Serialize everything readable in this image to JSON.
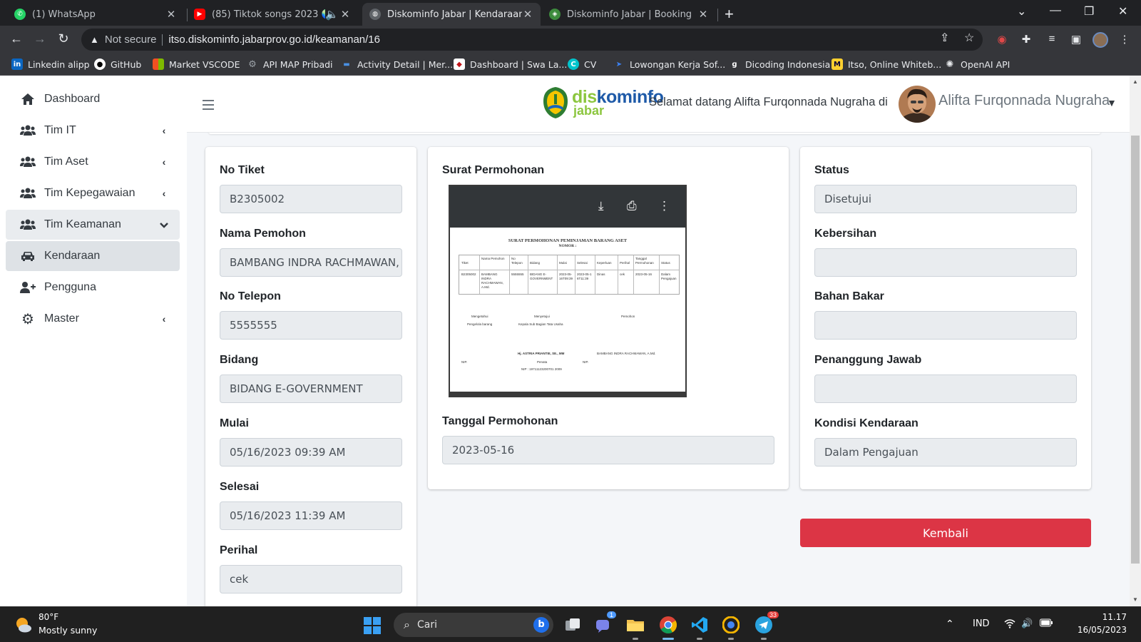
{
  "browser": {
    "tabs": [
      {
        "title": "(1) WhatsApp",
        "icon": "whatsapp-icon"
      },
      {
        "title": "(85) Tiktok songs 2023 🌏 Tr",
        "icon": "youtube-icon"
      },
      {
        "title": "Diskominfo Jabar | Kendaraan",
        "icon": "globe-icon",
        "active": true
      },
      {
        "title": "Diskominfo Jabar | Booking",
        "icon": "diskominfo-icon"
      }
    ],
    "security_label": "Not secure",
    "url": "itso.diskominfo.jabarprov.go.id/keamanan/16",
    "bookmarks": [
      {
        "label": "Linkedin alipp",
        "icon": "linkedin-icon"
      },
      {
        "label": "GitHub",
        "icon": "github-icon"
      },
      {
        "label": "Market VSCODE",
        "icon": "microsoft-icon"
      },
      {
        "label": "API MAP Pribadi",
        "icon": "gear-icon"
      },
      {
        "label": "Activity Detail | Mer...",
        "icon": "bar-icon"
      },
      {
        "label": "Dashboard | Swa La...",
        "icon": "shield-icon"
      },
      {
        "label": "CV",
        "icon": "canva-icon"
      },
      {
        "label": "Lowongan Kerja Sof...",
        "icon": "arrow-icon"
      },
      {
        "label": "Dicoding Indonesia",
        "icon": "dicoding-icon"
      },
      {
        "label": "Itso, Online Whiteb...",
        "icon": "miro-icon"
      },
      {
        "label": "OpenAI API",
        "icon": "openai-icon"
      }
    ]
  },
  "sidebar": {
    "items": [
      {
        "label": "Dashboard",
        "icon": "home-icon",
        "arrow": ""
      },
      {
        "label": "Tim IT",
        "icon": "users-icon",
        "arrow": "‹"
      },
      {
        "label": "Tim Aset",
        "icon": "users-icon",
        "arrow": "‹"
      },
      {
        "label": "Tim Kepegawaian",
        "icon": "users-icon",
        "arrow": "‹"
      },
      {
        "label": "Tim Keamanan",
        "icon": "users-icon",
        "arrow": "⌄"
      },
      {
        "label": "Kendaraan",
        "icon": "car-icon",
        "arrow": ""
      },
      {
        "label": "Pengguna",
        "icon": "user-plus-icon",
        "arrow": ""
      },
      {
        "label": "Master",
        "icon": "gear-icon",
        "arrow": "‹"
      }
    ]
  },
  "header": {
    "logo_text_1a": "dis",
    "logo_text_1b": "kominfo",
    "logo_text_2": "jabar",
    "welcome": "Selamat datang Alifta Furqonnada Nugraha di website Diskominfo Jabar",
    "username": "Alifta Furqonnada Nugraha"
  },
  "form": {
    "left": {
      "no_tiket": {
        "label": "No Tiket",
        "value": "B2305002"
      },
      "nama_pemohon": {
        "label": "Nama Pemohon",
        "value": "BAMBANG INDRA RACHMAWAN, A.Md."
      },
      "no_telepon": {
        "label": "No Telepon",
        "value": "5555555"
      },
      "bidang": {
        "label": "Bidang",
        "value": "BIDANG E-GOVERNMENT"
      },
      "mulai": {
        "label": "Mulai",
        "value": "05/16/2023 09:39 AM"
      },
      "selesai": {
        "label": "Selesai",
        "value": "05/16/2023 11:39 AM"
      },
      "perihal": {
        "label": "Perihal",
        "value": "cek"
      }
    },
    "middle": {
      "surat_label": "Surat Permohonan",
      "tanggal": {
        "label": "Tanggal Permohonan",
        "value": "2023-05-16"
      }
    },
    "right": {
      "status": {
        "label": "Status",
        "value": "Disetujui"
      },
      "kebersihan": {
        "label": "Kebersihan",
        "value": ""
      },
      "bahan_bakar": {
        "label": "Bahan Bakar",
        "value": ""
      },
      "penanggung_jawab": {
        "label": "Penanggung Jawab",
        "value": ""
      },
      "kondisi": {
        "label": "Kondisi Kendaraan",
        "value": "Dalam Pengajuan"
      }
    },
    "back_button": "Kembali"
  },
  "pdf": {
    "title": "SURAT PERMOHONAN PEMINJAMAN BARANG ASET",
    "nomor": "NOMOR :",
    "headers": [
      "Tiket",
      "Nama Pemohon",
      "No Telepon",
      "Bidang",
      "Mulai",
      "Selesai",
      "Keperluan",
      "Perihal",
      "Tanggal Permohonan",
      "Status"
    ],
    "row": [
      "B2305002",
      "BAMBANG INDRA RACHMAWAN, A.Md.",
      "5555555",
      "BIDANG E-GOVERNMENT",
      "2023-05-16T09:39",
      "2023-05-16T11:39",
      "Dinas",
      "cek",
      "2023-05-16",
      "Dalam Pengajuan"
    ],
    "sig_1": "Mengetahui",
    "sig_1b": "Pengelola barang",
    "sig_2": "Menyetujui",
    "sig_2b": "Kepala Sub Bagian Tata Usaha",
    "sig_3": "Pemohon",
    "name_2": "Hj. ASTRIA PRIANTIE, SE., MM",
    "name_3": "BAMBANG INDRA RACHMAWAN, A.Md.",
    "nip_1": "NIP.",
    "rank_2": "Penata",
    "nip_2": "NIP : 19711123200701 2009",
    "nip_3": "NIP."
  },
  "taskbar": {
    "temperature": "80°F",
    "weather": "Mostly sunny",
    "search_placeholder": "Cari",
    "language": "IND",
    "time": "11.17",
    "date": "16/05/2023",
    "teams_badge": "1",
    "telegram_badge": "33"
  }
}
